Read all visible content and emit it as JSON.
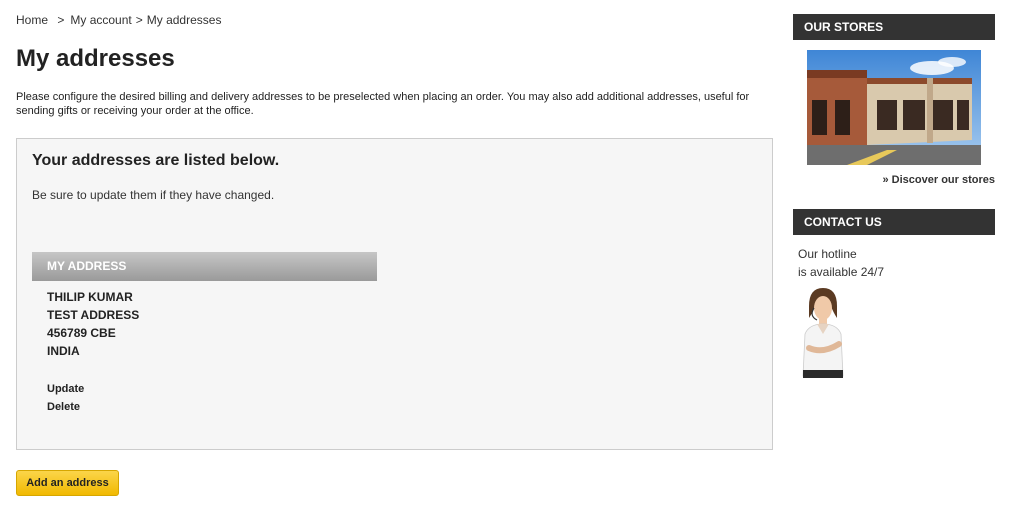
{
  "breadcrumb": {
    "home": "Home",
    "sep1": ">",
    "account": "My account",
    "sep2": ">",
    "current": "My addresses"
  },
  "page": {
    "title": "My addresses",
    "intro": "Please configure the desired billing and delivery addresses to be preselected when placing an order. You may also add additional addresses, useful for sending gifts or receiving your order at the office."
  },
  "addresses_box": {
    "title": "Your addresses are listed below.",
    "subtitle": "Be sure to update them if they have changed.",
    "address": {
      "heading": "MY ADDRESS",
      "name": "THILIP KUMAR",
      "line1": "TEST ADDRESS",
      "line2": "456789 CBE",
      "country": "INDIA",
      "update_label": "Update",
      "delete_label": "Delete"
    }
  },
  "actions": {
    "add_address_label": "Add an address"
  },
  "sidebar": {
    "stores_heading": "OUR STORES",
    "stores_image": "store-photo",
    "discover_label": "» Discover our stores",
    "contact_heading": "CONTACT US",
    "hotline_line1": "Our hotline",
    "hotline_line2": "is available 24/7",
    "agent_image": "support-agent-photo"
  },
  "colors": {
    "button_yellow": "#f1b900",
    "sidebar_header": "#333333",
    "box_background": "#f6f6f6"
  }
}
